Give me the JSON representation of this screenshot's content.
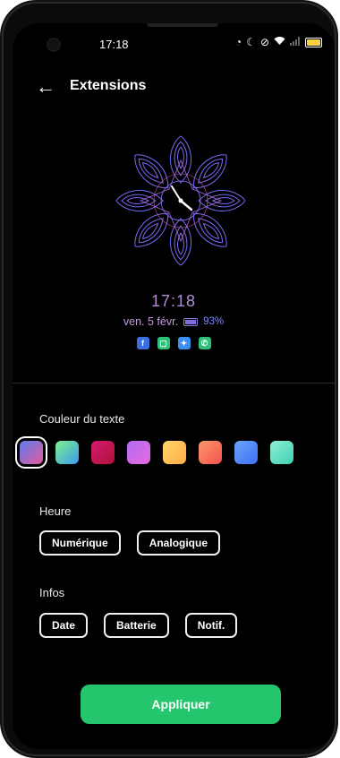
{
  "status_bar": {
    "time": "17:18",
    "icons": [
      "alarm-icon",
      "do-not-disturb-icon",
      "vibrate-icon",
      "wifi-icon",
      "signal-icon",
      "battery-icon"
    ]
  },
  "header": {
    "back_icon": "back-arrow-icon",
    "title": "Extensions"
  },
  "preview": {
    "clock_time": "17:18",
    "date": "ven. 5 févr.",
    "battery_percent": "93%",
    "notification_icons": [
      "facebook-icon",
      "messages-icon",
      "twitter-icon",
      "phone-icon"
    ]
  },
  "text_color": {
    "label": "Couleur du texte",
    "swatches": [
      {
        "name": "blue-pink",
        "from": "#5b7cf0",
        "to": "#e45a9a",
        "selected": true
      },
      {
        "name": "green-blue",
        "from": "#7ef08a",
        "to": "#3a9cf0"
      },
      {
        "name": "magenta-red",
        "from": "#d41a6e",
        "to": "#b0123c"
      },
      {
        "name": "violet-pink",
        "from": "#b46cf2",
        "to": "#e66ae0"
      },
      {
        "name": "yellow-orange",
        "from": "#ffd56a",
        "to": "#ffac48"
      },
      {
        "name": "orange-red",
        "from": "#ff9a6a",
        "to": "#f2504e"
      },
      {
        "name": "blue",
        "from": "#6aa5ff",
        "to": "#3d6ef0"
      },
      {
        "name": "mint",
        "from": "#8ff0d3",
        "to": "#3fd0b4"
      }
    ]
  },
  "time_section": {
    "label": "Heure",
    "options": [
      "Numérique",
      "Analogique"
    ]
  },
  "info_section": {
    "label": "Infos",
    "options": [
      "Date",
      "Batterie",
      "Notif."
    ]
  },
  "apply_button": "Appliquer"
}
